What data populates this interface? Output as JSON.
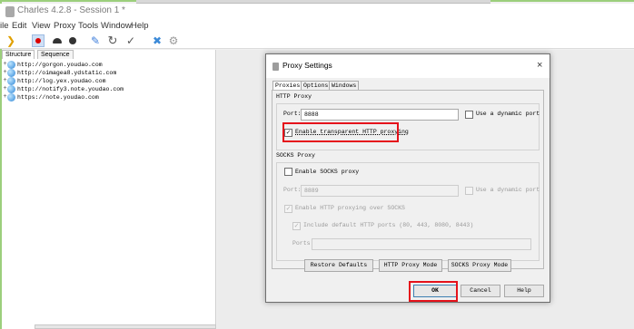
{
  "window": {
    "title": "Charles 4.2.8 - Session 1 *"
  },
  "menu": [
    "File",
    "Edit",
    "View",
    "Proxy",
    "Tools",
    "Window",
    "Help"
  ],
  "menu_display": [
    "ile",
    "Edit",
    "View",
    "Proxy",
    "Tools",
    "Window",
    "Help"
  ],
  "toolbar": {
    "icons": [
      "broom-icon",
      "record-icon",
      "throttle-icon",
      "stop-icon",
      "pen-icon",
      "refresh-icon",
      "check-icon",
      "tools-icon",
      "gear-icon"
    ],
    "recording_highlight": "#cfe0f6"
  },
  "left_panel": {
    "tabs": [
      "Structure",
      "Sequence"
    ],
    "tree": [
      {
        "expander": "+",
        "url": "http://gorgon.youdao.com"
      },
      {
        "expander": "+",
        "url": "http://oimagea8.ydstatic.com"
      },
      {
        "expander": "+",
        "url": "http://log.yex.youdao.com"
      },
      {
        "expander": "+",
        "url": "http://notify3.note.youdao.com"
      },
      {
        "expander": "+",
        "url": "https://note.youdao.com"
      }
    ]
  },
  "dialog": {
    "title": "Proxy Settings",
    "close_symbol": "×",
    "tabs": [
      "Proxies",
      "Options",
      "Windows"
    ],
    "http_proxy": {
      "group_title": "HTTP Proxy",
      "port_label": "Port:",
      "port_value": "8888",
      "dynamic_port_label": "Use a dynamic port",
      "dynamic_port_checked": false,
      "transparent_label": "Enable transparent HTTP proxying",
      "transparent_checked": true
    },
    "socks_proxy": {
      "group_title": "SOCKS Proxy",
      "enable_label": "Enable SOCKS proxy",
      "enable_checked": false,
      "port_label": "Port:",
      "port_value": "8889",
      "dynamic_port_label": "Use a dynamic port",
      "http_over_socks_label": "Enable HTTP proxying over SOCKS",
      "default_ports_label": "Include default HTTP ports (80, 443, 8080, 8443)",
      "ports_label": "Ports:",
      "ports_value": ""
    },
    "buttons": {
      "restore_defaults": "Restore Defaults",
      "http_proxy_mode": "HTTP Proxy Mode",
      "socks_proxy_mode": "SOCKS Proxy Mode",
      "ok": "OK",
      "cancel": "Cancel",
      "help": "Help"
    },
    "check_mark": "✓",
    "highlight_color": "#e5121b"
  },
  "frame_color": "#9ccf7c"
}
